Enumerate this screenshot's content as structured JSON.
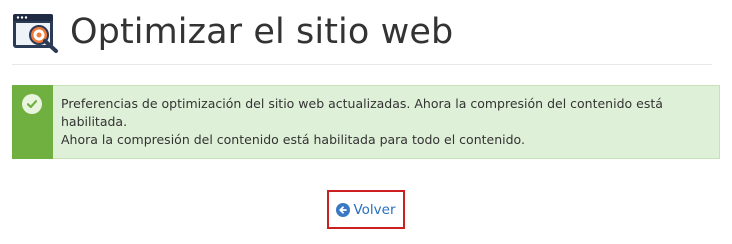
{
  "page": {
    "title": "Optimizar el sitio web",
    "icon": "optimize-website-icon"
  },
  "alert": {
    "type": "success",
    "icon": "check-circle-icon",
    "line1": "Preferencias de optimización del sitio web actualizadas. Ahora la compresión del contenido está habilitada.",
    "line2": "Ahora la compresión del contenido está habilitada para todo el contenido."
  },
  "back_link": {
    "label": "Volver",
    "icon": "arrow-left-circle-icon"
  },
  "colors": {
    "alert_background": "#dff0d8",
    "alert_stripe": "#6fb040",
    "link": "#2a6fbe",
    "highlight_border": "#cc1f1f"
  }
}
